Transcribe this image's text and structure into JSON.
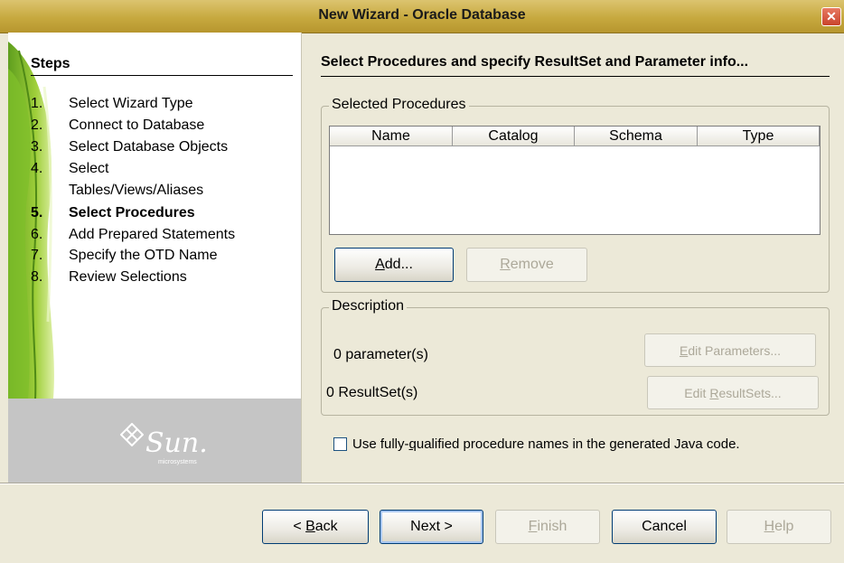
{
  "window": {
    "title": "New Wizard - Oracle Database",
    "close_glyph": "✕"
  },
  "steps": {
    "heading": "Steps",
    "items": [
      {
        "num": "1.",
        "label": "Select Wizard Type"
      },
      {
        "num": "2.",
        "label": "Connect to Database"
      },
      {
        "num": "3.",
        "label": "Select Database Objects"
      },
      {
        "num": "4.",
        "label": "Select"
      },
      {
        "num": "",
        "label": "Tables/Views/Aliases"
      },
      {
        "num": "5.",
        "label": "Select Procedures"
      },
      {
        "num": "6.",
        "label": "Add Prepared Statements"
      },
      {
        "num": "7.",
        "label": "Specify the OTD Name"
      },
      {
        "num": "8.",
        "label": "Review Selections"
      }
    ],
    "current_index": 5
  },
  "logo": {
    "text": "Sun.",
    "subtext": "microsystems"
  },
  "main": {
    "title": "Select Procedures and specify ResultSet and Parameter info...",
    "selected_procedures": {
      "legend": "Selected Procedures",
      "columns": [
        "Name",
        "Catalog",
        "Schema",
        "Type"
      ],
      "rows": [],
      "add_pre": "",
      "add_mn": "A",
      "add_post": "dd...",
      "remove_pre": "",
      "remove_mn": "R",
      "remove_post": "emove"
    },
    "description": {
      "legend": "Description",
      "parameters": "0 parameter(s)",
      "resultsets": "0 ResultSet(s)",
      "edit_params_pre": "",
      "edit_params_mn": "E",
      "edit_params_post": "dit Parameters...",
      "edit_rs_pre": "Edit ",
      "edit_rs_mn": "R",
      "edit_rs_post": "esultSets..."
    },
    "fq_pre": "Use fully-",
    "fq_mn": "q",
    "fq_post": "ualified procedure names in the generated Java code.",
    "fq_checked": false
  },
  "footer": {
    "back_pre": "< ",
    "back_mn": "B",
    "back_post": "ack",
    "next": "Next >",
    "finish_pre": "",
    "finish_mn": "F",
    "finish_post": "inish",
    "cancel": "Cancel",
    "help_pre": "",
    "help_mn": "H",
    "help_post": "elp"
  }
}
